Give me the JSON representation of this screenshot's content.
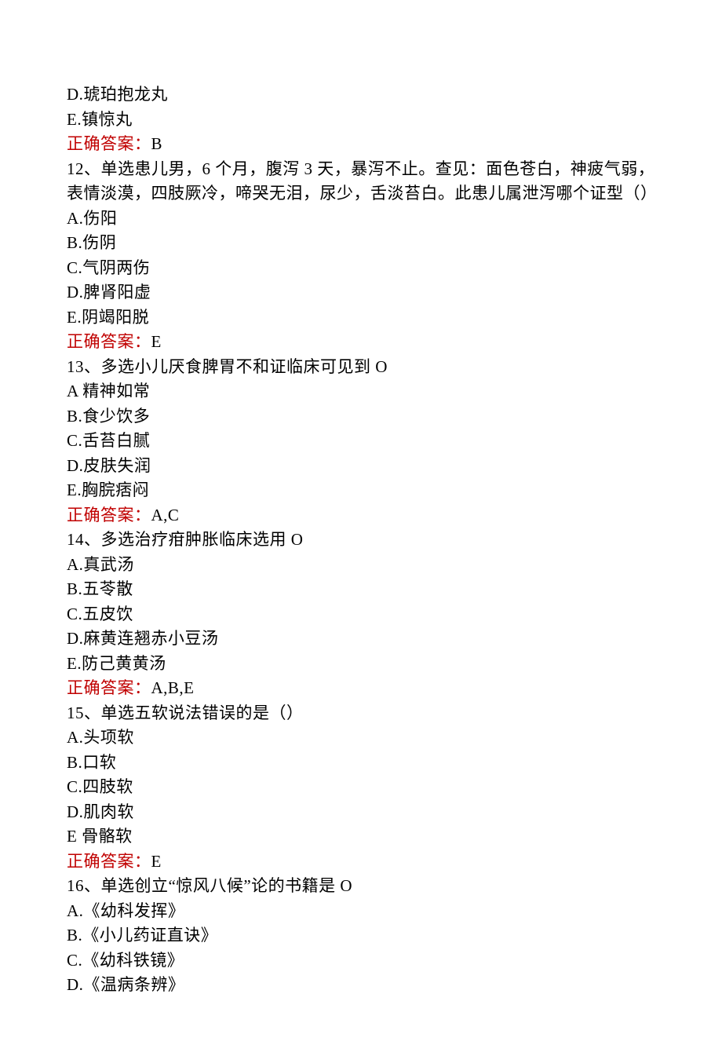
{
  "q11": {
    "opt_d": "D.琥珀抱龙丸",
    "opt_e": "E.镇惊丸",
    "ans_label": "正确答案：",
    "ans_value": "B"
  },
  "q12": {
    "stem": "12、单选患儿男，6 个月，腹泻 3 天，暴泻不止。查见：面色苍白，神疲气弱，表情淡漠，四肢厥冷，啼哭无泪，尿少，舌淡苔白。此患儿属泄泻哪个证型（）",
    "opt_a": "A.伤阳",
    "opt_b": "B.伤阴",
    "opt_c": "C.气阴两伤",
    "opt_d": "D.脾肾阳虚",
    "opt_e": "E.阴竭阳脱",
    "ans_label": "正确答案：",
    "ans_value": "E"
  },
  "q13": {
    "stem": "13、多选小儿厌食脾胃不和证临床可见到 O",
    "opt_a": "A 精神如常",
    "opt_b": "B.食少饮多",
    "opt_c": "C.舌苔白腻",
    "opt_d": "D.皮肤失润",
    "opt_e": "E.胸脘痞闷",
    "ans_label": "正确答案：",
    "ans_value": "A,C"
  },
  "q14": {
    "stem": "14、多选治疗疳肿胀临床选用 O",
    "opt_a": "A.真武汤",
    "opt_b": "B.五苓散",
    "opt_c": "C.五皮饮",
    "opt_d": "D.麻黄连翘赤小豆汤",
    "opt_e": "E.防己黄黄汤",
    "ans_label": "正确答案：",
    "ans_value": "A,B,E"
  },
  "q15": {
    "stem": "15、单选五软说法错误的是（）",
    "opt_a": "A.头项软",
    "opt_b": "B.口软",
    "opt_c": "C.四肢软",
    "opt_d": "D.肌肉软",
    "opt_e": "E 骨骼软",
    "ans_label": "正确答案：",
    "ans_value": "E"
  },
  "q16": {
    "stem": "16、单选创立“惊风八候”论的书籍是 O",
    "opt_a": "A.《幼科发挥》",
    "opt_b": "B.《小儿药证直诀》",
    "opt_c": "C.《幼科铁镜》",
    "opt_d": "D.《温病条辨》"
  }
}
